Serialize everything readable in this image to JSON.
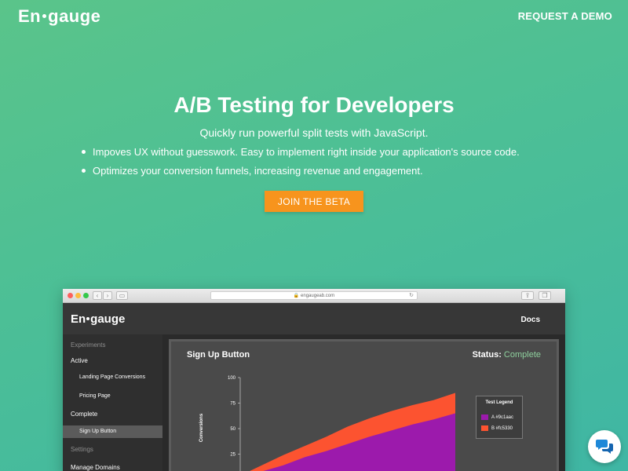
{
  "header": {
    "logo_left": "En",
    "logo_right": "gauge",
    "demo_link": "REQUEST A DEMO"
  },
  "hero": {
    "title": "A/B Testing for Developers",
    "subtitle": "Quickly run powerful split tests with JavaScript.",
    "bullets": [
      "Impoves UX without guesswork. Easy to implement right inside your application's source code.",
      "Optimizes your conversion funnels, increasing revenue and engagement."
    ],
    "cta_label": "JOIN THE BETA"
  },
  "browser": {
    "url": "🔒 engaugeab.com",
    "app_logo_left": "En",
    "app_logo_right": "gauge",
    "docs_link": "Docs",
    "sidebar": {
      "experiments_label": "Experiments",
      "active_label": "Active",
      "active_items": [
        "Landing Page Conversions",
        "Pricing Page"
      ],
      "complete_label": "Complete",
      "complete_items": [
        "Sign Up Button"
      ],
      "settings_label": "Settings",
      "manage_domains": "Manage Domains"
    },
    "panel": {
      "title": "Sign Up Button",
      "status_label": "Status:",
      "status_value": "Complete"
    }
  },
  "colors": {
    "background_start": "#5ac48a",
    "background_end": "#3fb6a4",
    "cta": "#f7941d",
    "series_a": "#9c1aac",
    "series_b": "#fc5330",
    "status_complete": "#8fd19e"
  },
  "icons": {
    "chat_button": "chat-bubbles-icon"
  },
  "chart_data": {
    "type": "area",
    "title": "",
    "ylabel": "Conversions",
    "ylim": [
      0,
      100
    ],
    "yticks": [
      25,
      50,
      75,
      100
    ],
    "legend_title": "Test Legend",
    "x": [
      0,
      1,
      2,
      3,
      4,
      5,
      6,
      7,
      8,
      9,
      10
    ],
    "series": [
      {
        "name": "A #9c1aac",
        "color": "#9c1aac",
        "values": [
          2,
          8,
          14,
          22,
          28,
          35,
          42,
          48,
          54,
          59,
          65
        ]
      },
      {
        "name": "B #fc5330",
        "color": "#fc5330",
        "values": [
          4,
          14,
          24,
          33,
          42,
          52,
          60,
          67,
          73,
          78,
          85
        ]
      }
    ]
  }
}
